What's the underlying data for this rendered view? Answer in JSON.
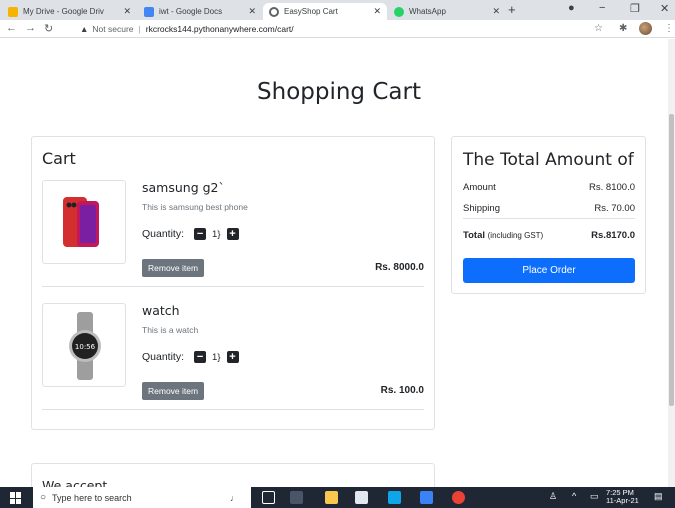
{
  "browser": {
    "tabs": [
      {
        "label": "My Drive - Google Driv",
        "color": "#f4b400",
        "active": false
      },
      {
        "label": "iwt - Google Docs",
        "color": "#4285f4",
        "active": false
      },
      {
        "label": "EasyShop Cart",
        "color": "#5f6368",
        "active": true
      },
      {
        "label": "WhatsApp",
        "color": "#25d366",
        "active": false
      }
    ],
    "new_tab": "+",
    "security": "Not secure",
    "url": "rkcrocks144.pythonanywhere.com/cart/"
  },
  "page": {
    "title": "Shopping Cart",
    "cart": {
      "heading": "Cart",
      "quantity_label": "Quantity:",
      "remove_label": "Remove item",
      "items": [
        {
          "name": "samsung g2`",
          "desc": "This is samsung best phone",
          "qty": "1}",
          "price": "Rs. 8000.0",
          "image_icon": "phone-image"
        },
        {
          "name": "watch",
          "desc": "This is a watch",
          "qty": "1}",
          "price": "Rs. 100.0",
          "image_icon": "watch-image",
          "watch_time": "10:56"
        }
      ]
    },
    "total": {
      "heading": "The Total Amount of",
      "amount_label": "Amount",
      "amount_value": "Rs. 8100.0",
      "shipping_label": "Shipping",
      "shipping_value": "Rs. 70.00",
      "total_label": "Total",
      "total_note": "(including GST)",
      "total_value": "Rs.8170.0",
      "place_order": "Place Order"
    },
    "accept_heading": "We accept"
  },
  "taskbar": {
    "search_placeholder": "Type here to search",
    "time": "7:25 PM",
    "date": "11-Apr-21"
  },
  "colors": {
    "accent": "#0d6efd",
    "remove_button": "#6c757d",
    "taskbar": "#1f2735"
  }
}
